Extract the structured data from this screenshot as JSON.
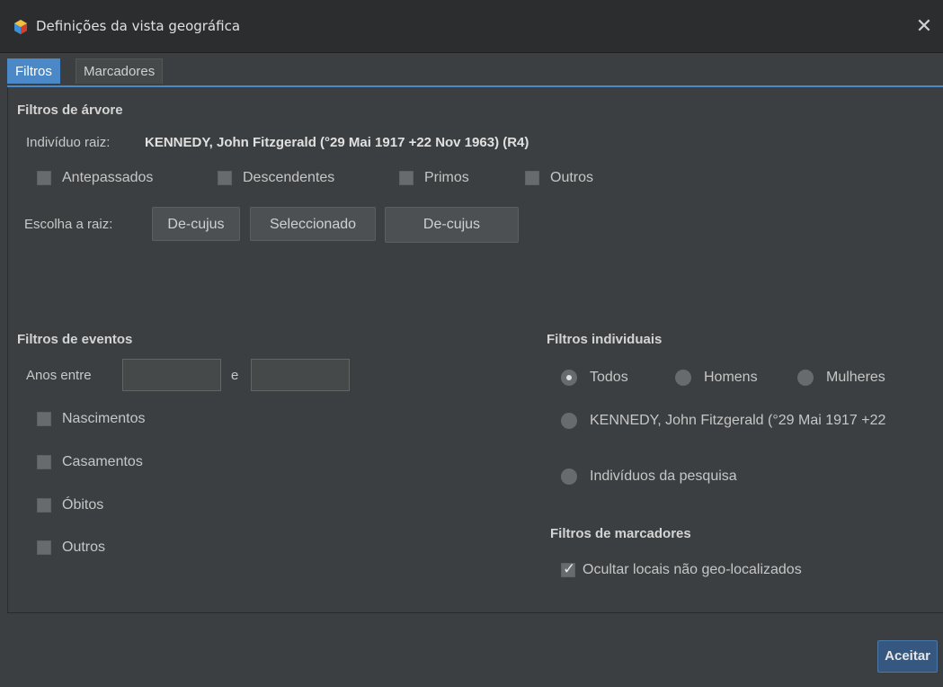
{
  "window": {
    "title": "Definições da vista geográfica",
    "close_symbol": "✕"
  },
  "tabs": [
    {
      "label": "Filtros",
      "active": true
    },
    {
      "label": "Marcadores",
      "active": false
    }
  ],
  "tree_filters": {
    "title": "Filtros de árvore",
    "root_label": "Indivíduo raiz:",
    "root_value": "KENNEDY, John Fitzgerald (°29 Mai 1917 +22 Nov 1963) (R4)",
    "checkboxes": [
      {
        "label": "Antepassados",
        "checked": false
      },
      {
        "label": "Descendentes",
        "checked": false
      },
      {
        "label": "Primos",
        "checked": false
      },
      {
        "label": "Outros",
        "checked": false
      }
    ],
    "choose_root_label": "Escolha a raiz:",
    "buttons": {
      "decujus": "De-cujus",
      "selected": "Seleccionado",
      "current_root": "De-cujus"
    }
  },
  "event_filters": {
    "title": "Filtros de eventos",
    "years_label": "Anos entre",
    "and_label": "e",
    "year_from": "",
    "year_to": "",
    "checkboxes": [
      {
        "label": "Nascimentos",
        "checked": false
      },
      {
        "label": "Casamentos",
        "checked": false
      },
      {
        "label": "Óbitos",
        "checked": false
      },
      {
        "label": "Outros",
        "checked": false
      }
    ]
  },
  "individual_filters": {
    "title": "Filtros individuais",
    "radios": [
      {
        "label": "Todos",
        "checked": true
      },
      {
        "label": "Homens",
        "checked": false
      },
      {
        "label": "Mulheres",
        "checked": false
      },
      {
        "label": "KENNEDY, John Fitzgerald (°29 Mai 1917 +22",
        "checked": false
      },
      {
        "label": "Indivíduos da pesquisa",
        "checked": false
      }
    ]
  },
  "marker_filters": {
    "title": "Filtros de marcadores",
    "hide_label": "Ocultar locais não geo-localizados",
    "hide_checked": true
  },
  "footer": {
    "accept_label": "Aceitar"
  },
  "colors": {
    "background": "#3c3f41",
    "accent": "#4a88c7",
    "accept": "#365880"
  }
}
